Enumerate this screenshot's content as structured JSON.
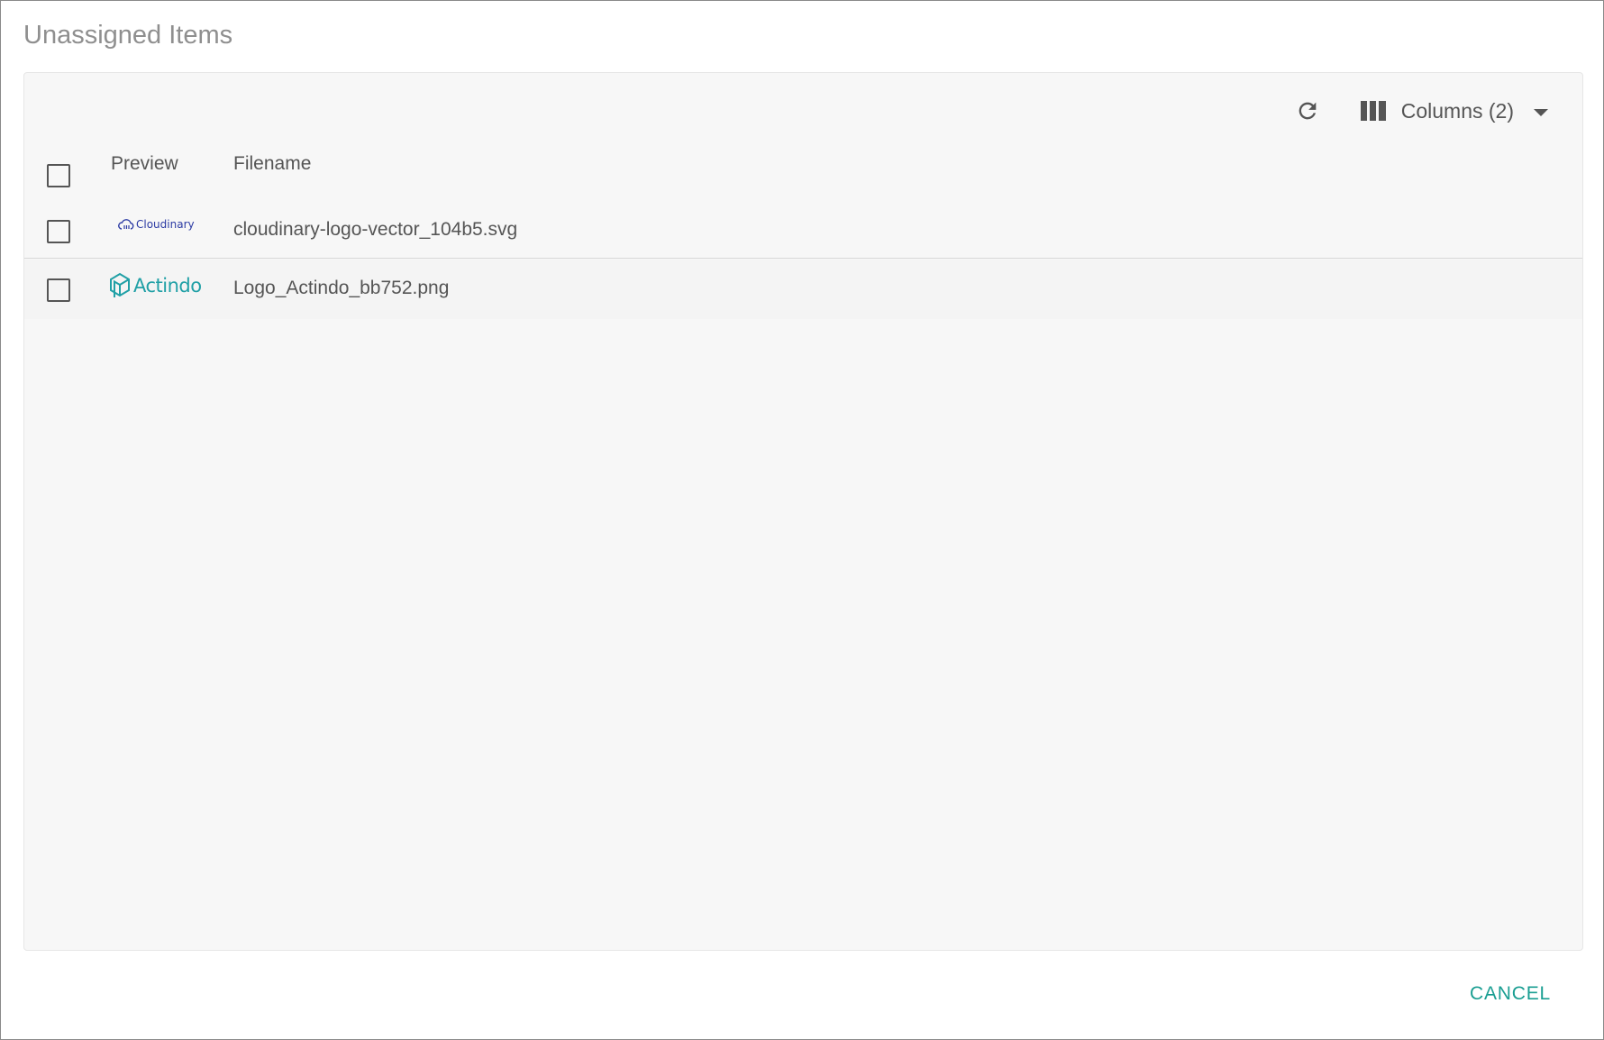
{
  "dialog": {
    "title": "Unassigned Items",
    "cancel_label": "CANCEL"
  },
  "toolbar": {
    "columns_label": "Columns (2)"
  },
  "table": {
    "headers": [
      "Preview",
      "Filename"
    ],
    "rows": [
      {
        "preview_text": "Cloudinary",
        "filename": "cloudinary-logo-vector_104b5.svg",
        "checked": false
      },
      {
        "preview_text": "Actindo",
        "filename": "Logo_Actindo_bb752.png",
        "checked": false
      }
    ]
  },
  "colors": {
    "accent": "#1a9e92",
    "cloudinary_brand": "#2b3aa3",
    "actindo_brand": "#20a0a6"
  },
  "icons": [
    "refresh-icon",
    "columns-icon",
    "chevron-down-icon",
    "cloudinary-logo",
    "actindo-logo"
  ]
}
